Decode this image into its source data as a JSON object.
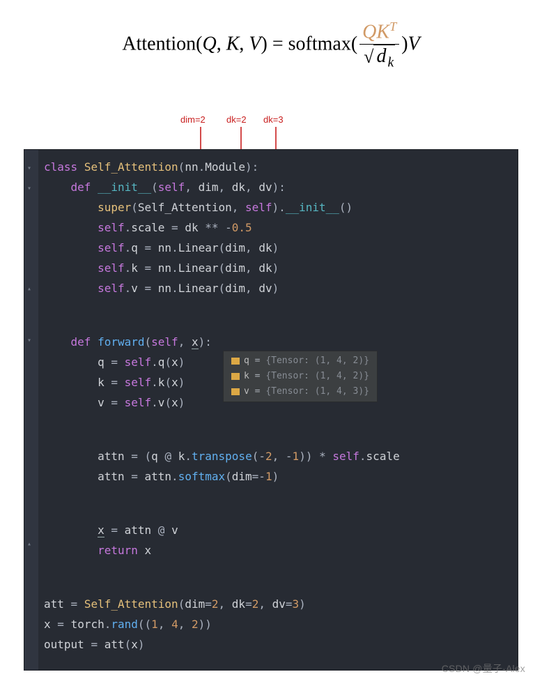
{
  "formula": {
    "lhs_prefix": "Attention(",
    "Q": "Q",
    "K": "K",
    "V": "V",
    "lhs_close": ") = ",
    "softmax": "softmax(",
    "frac_num": "QK",
    "frac_num_sup": "T",
    "frac_den_d": "d",
    "frac_den_sub": "k",
    "close": ")",
    "trailV": "V"
  },
  "annotations": {
    "labels": [
      "dim=2",
      "dk=2",
      "dk=3"
    ]
  },
  "code": {
    "l01": "class Self_Attention(nn.Module):",
    "l02": "    def __init__(self, dim, dk, dv):",
    "l03": "        super(Self_Attention, self).__init__()",
    "l04": "        self.scale = dk ** -0.5",
    "l05": "        self.q = nn.Linear(dim, dk)",
    "l06": "        self.k = nn.Linear(dim, dk)",
    "l07": "        self.v = nn.Linear(dim, dv)",
    "l09": "    def forward(self, x):",
    "l10": "        q = self.q(x)",
    "l11": "        k = self.k(x)",
    "l12": "        v = self.v(x)",
    "l14": "        attn = (q @ k.transpose(-2, -1)) * self.scale",
    "l15": "        attn = attn.softmax(dim=-1)",
    "l17": "        x = attn @ v",
    "l18": "        return x",
    "l21": "att = Self_Attention(dim=2, dk=2, dv=3)",
    "l22": "x = torch.rand((1, 4, 2))",
    "l23": "output = att(x)"
  },
  "tooltip": {
    "rows": [
      {
        "var": "q",
        "val": "{Tensor: (1, 4, 2)}"
      },
      {
        "var": "k",
        "val": "{Tensor: (1, 4, 2)}"
      },
      {
        "var": "v",
        "val": "{Tensor: (1, 4, 3)}"
      }
    ]
  },
  "watermark": "CSDN @量子-Alex"
}
